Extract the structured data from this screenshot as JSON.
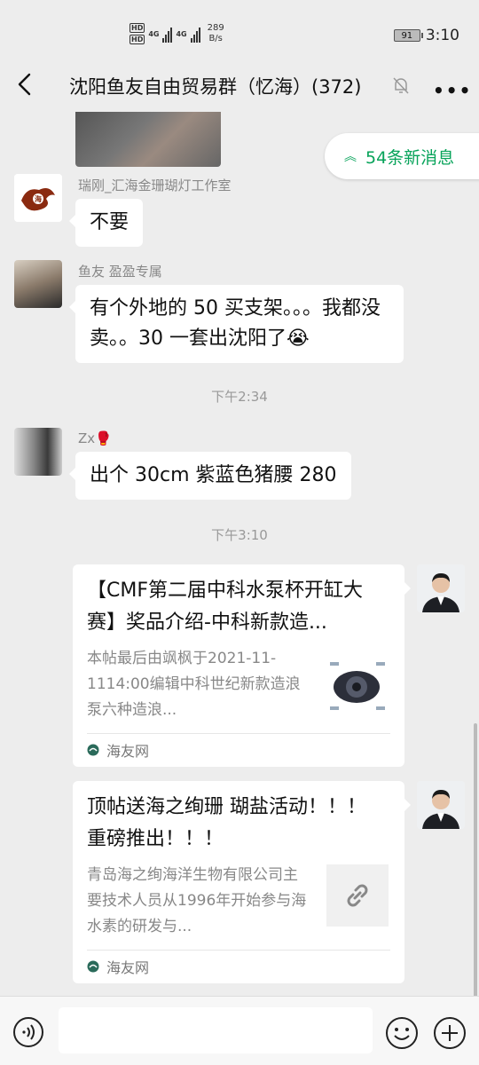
{
  "status_bar": {
    "hd1": "HD",
    "hd2": "HD",
    "net1": "4G",
    "net2": "4G",
    "speed_value": "289",
    "speed_unit": "B/s",
    "battery": "91",
    "time": "3:10"
  },
  "header": {
    "title": "沈阳鱼友自由贸易群（忆海）(372)"
  },
  "new_messages": {
    "label": "54条新消息"
  },
  "messages": [
    {
      "sender": "瑞刚_汇海金珊瑚灯工作室",
      "text": "不要"
    },
    {
      "sender": "鱼友 盈盈专属",
      "text": "有个外地的 50 买支架。。。我都没卖。。30 一套出沈阳了😭"
    },
    {
      "sender": "Zx🥊",
      "text": "出个 30cm 紫蓝色猪腰 280"
    }
  ],
  "timestamps": [
    "下午2:34",
    "下午3:10"
  ],
  "cards": [
    {
      "title": "【CMF第二届中科水泵杯开缸大赛】奖品介绍-中科新款造...",
      "desc": "本帖最后由飒枫于2021-11-1114:00编辑中科世纪新款造浪泵六种造浪...",
      "source": "海友网",
      "thumb_icon": "pump-thumbnail"
    },
    {
      "title": "顶帖送海之绚珊 瑚盐活动！！！ 重磅推出！！！",
      "desc": "青岛海之绚海洋生物有限公司主要技术人员从1996年开始参与海水素的研发与...",
      "source": "海友网",
      "thumb_icon": "link-icon"
    }
  ],
  "colors": {
    "accent_green": "#07a35a",
    "chat_background": "#ededed"
  }
}
